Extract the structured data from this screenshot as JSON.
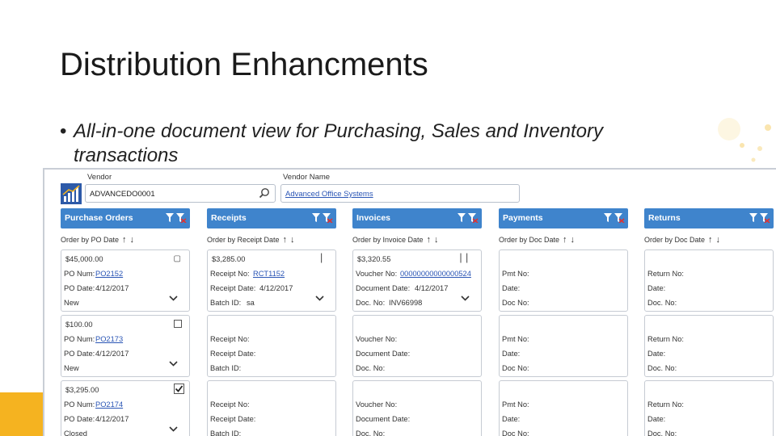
{
  "slide": {
    "title": "Distribution Enhancments",
    "bullet_line1": "All-in-one document view for Purchasing, Sales and Inventory",
    "bullet_line2": "transactions"
  },
  "vendor": {
    "id_label": "Vendor",
    "id_value": "ADVANCEDO0001",
    "name_label": "Vendor Name",
    "name_value": "Advanced Office Systems"
  },
  "columns": [
    {
      "title": "Purchase Orders",
      "order": "Order by PO Date",
      "cards": [
        {
          "amount": "$45,000.00",
          "r1": "PO Num:",
          "r1v": "PO2152",
          "r2": "PO Date:",
          "r2v": "4/12/2017",
          "r3": "New",
          "r3v": ""
        },
        {
          "amount": "$100.00",
          "r1": "PO Num:",
          "r1v": "PO2173",
          "r2": "PO Date:",
          "r2v": "4/12/2017",
          "r3": "New",
          "r3v": ""
        },
        {
          "amount": "$3,295.00",
          "r1": "PO Num:",
          "r1v": "PO2174",
          "r2": "PO Date:",
          "r2v": "4/12/2017",
          "r3": "Closed",
          "r3v": ""
        }
      ]
    },
    {
      "title": "Receipts",
      "order": "Order by Receipt Date",
      "cards": [
        {
          "amount": "$3,285.00",
          "r1": "Receipt No:",
          "r1v": "RCT1152",
          "r2": "Receipt Date:",
          "r2v": "4/12/2017",
          "r3": "Batch ID:",
          "r3v": "sa"
        },
        {
          "amount": "",
          "r1": "Receipt No:",
          "r1v": "",
          "r2": "Receipt Date:",
          "r2v": "",
          "r3": "Batch ID:",
          "r3v": ""
        },
        {
          "amount": "",
          "r1": "Receipt No:",
          "r1v": "",
          "r2": "Receipt Date:",
          "r2v": "",
          "r3": "Batch ID:",
          "r3v": ""
        }
      ]
    },
    {
      "title": "Invoices",
      "order": "Order by Invoice Date",
      "cards": [
        {
          "amount": "$3,320.55",
          "r1": "Voucher No:",
          "r1v": "00000000000000524",
          "r2": "Document Date:",
          "r2v": "4/12/2017",
          "r3": "Doc. No:",
          "r3v": "INV66998"
        },
        {
          "amount": "",
          "r1": "Voucher No:",
          "r1v": "",
          "r2": "Document Date:",
          "r2v": "",
          "r3": "Doc. No:",
          "r3v": ""
        },
        {
          "amount": "",
          "r1": "Voucher No:",
          "r1v": "",
          "r2": "Document Date:",
          "r2v": "",
          "r3": "Doc. No:",
          "r3v": ""
        }
      ]
    },
    {
      "title": "Payments",
      "order": "Order by Doc Date",
      "cards": [
        {
          "amount": "",
          "r1": "Pmt No:",
          "r1v": "",
          "r2": "Date:",
          "r2v": "",
          "r3": "Doc No:",
          "r3v": ""
        },
        {
          "amount": "",
          "r1": "Pmt No:",
          "r1v": "",
          "r2": "Date:",
          "r2v": "",
          "r3": "Doc No:",
          "r3v": ""
        },
        {
          "amount": "",
          "r1": "Pmt No:",
          "r1v": "",
          "r2": "Date:",
          "r2v": "",
          "r3": "Doc No:",
          "r3v": ""
        }
      ]
    },
    {
      "title": "Returns",
      "order": "Order by Doc Date",
      "cards": [
        {
          "amount": "",
          "r1": "Return No:",
          "r1v": "",
          "r2": "Date:",
          "r2v": "",
          "r3": "Doc. No:",
          "r3v": ""
        },
        {
          "amount": "",
          "r1": "Return No:",
          "r1v": "",
          "r2": "Date:",
          "r2v": "",
          "r3": "Doc. No:",
          "r3v": ""
        },
        {
          "amount": "",
          "r1": "Return No:",
          "r1v": "",
          "r2": "Date:",
          "r2v": "",
          "r3": "Doc. No:",
          "r3v": ""
        }
      ]
    }
  ],
  "colors": {
    "header_blue": "#3f84cc",
    "link_blue": "#2a55b5",
    "accent_orange": "#f5b320"
  }
}
